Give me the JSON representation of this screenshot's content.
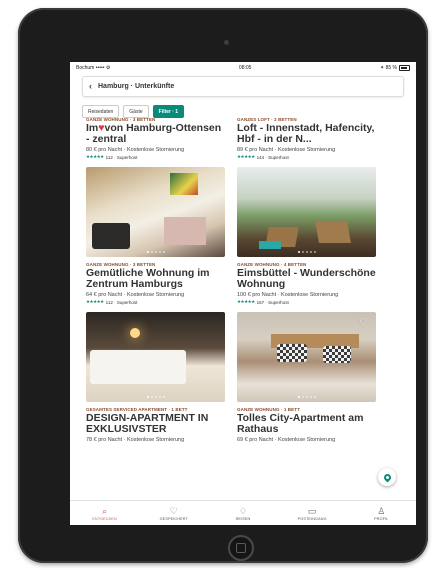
{
  "status": {
    "carrier": "Bochum ••••• ⚙",
    "time": "08:05",
    "battery": "✶ 85 %"
  },
  "search": {
    "text": "Hamburg · Unterkünfte"
  },
  "filters": [
    {
      "label": "Reisedaten",
      "active": false
    },
    {
      "label": "Gäste",
      "active": false
    },
    {
      "label": "Filter · 1",
      "active": true
    }
  ],
  "listings": [
    {
      "type": "GANZE WOHNUNG · 3 BETTEN",
      "title_pre": "Im",
      "title_heart": "♥",
      "title_post": "von Hamburg-Ottensen - zentral",
      "price": "80 € pro Nacht · Kostenlose Stornierung",
      "stars": "★★★★★",
      "reviews": "112 · Superhost"
    },
    {
      "type": "GANZES LOFT · 2 BETTEN",
      "title": "Loft - Innenstadt, Hafencity, Hbf - in der N...",
      "price": "89 € pro Nacht · Kostenlose Stornierung",
      "stars": "★★★★★",
      "reviews": "144 · Superhost"
    },
    {
      "type": "GANZE WOHNUNG · 3 BETTEN",
      "title": "Gemütliche Wohnung im Zentrum Hamburgs",
      "price": "64 € pro Nacht · Kostenlose Stornierung",
      "stars": "★★★★★",
      "reviews": "112 · Superhost"
    },
    {
      "type": "GANZE WOHNUNG · 4 BETTEN",
      "title": "Eimsbüttel - Wunderschöne Wohnung",
      "price": "100 € pro Nacht · Kostenlose Stornierung",
      "stars": "★★★★★",
      "reviews": "167 · Superhost"
    },
    {
      "type": "GESAMTES SERVICED APARTMENT · 1 BETT",
      "title": "DESIGN-APARTMENT IN EXKLUSIVSTER ALSTERL...",
      "price": "78 € pro Nacht · Kostenlose Stornierung",
      "stars": "",
      "reviews": ""
    },
    {
      "type": "GANZE WOHNUNG · 1 BETT",
      "title": "Tolles City-Apartment am Rathaus",
      "price": "69 € pro Nacht · Kostenlose Stornierung",
      "stars": "",
      "reviews": ""
    }
  ],
  "tabs": [
    {
      "label": "ENTDECKEN",
      "icon": "search-icon",
      "glyph": "⌕",
      "active": true
    },
    {
      "label": "GESPEICHERT",
      "icon": "heart-icon",
      "glyph": "♡",
      "active": false
    },
    {
      "label": "REISEN",
      "icon": "airbnb-logo-icon",
      "glyph": "♢",
      "active": false
    },
    {
      "label": "POSTEINGANG",
      "icon": "inbox-icon",
      "glyph": "▭",
      "active": false
    },
    {
      "label": "PROFIL",
      "icon": "profile-icon",
      "glyph": "♙",
      "active": false
    }
  ],
  "colors": {
    "accent": "#0a8b7a",
    "brand": "#e0564a",
    "type_label": "#8a4b28"
  }
}
